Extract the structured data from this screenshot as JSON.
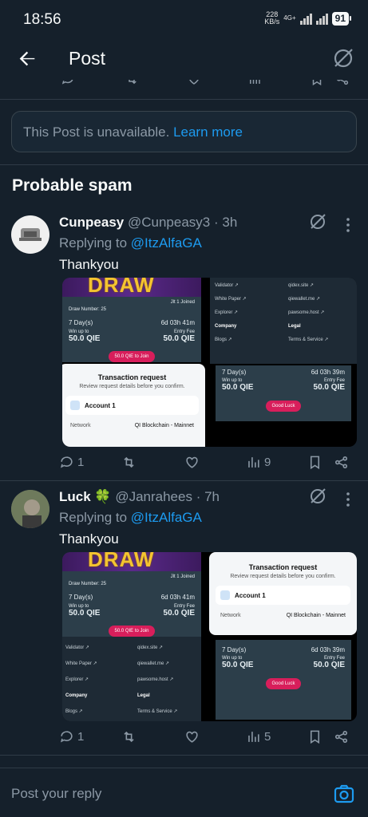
{
  "status": {
    "time": "18:56",
    "speed_value": "228",
    "speed_unit": "KB/s",
    "network": "4G+",
    "battery": "91"
  },
  "header": {
    "title": "Post",
    "back_icon": "arrow-left-icon",
    "grok_icon": "grok-icon"
  },
  "unavailable": {
    "text": "This Post is unavailable.",
    "link": "Learn more"
  },
  "section_title": "Probable spam",
  "replies": [
    {
      "name": "Cunpeasy",
      "handle": "@Cunpeasy3",
      "time": "· 3h",
      "replying_prefix": "Replying to",
      "replying_handle": "@ItzAlfaGA",
      "text": "Thankyou",
      "views": "9",
      "replies_count": "1",
      "retweets": "",
      "likes": ""
    },
    {
      "name": "Luck 🍀",
      "handle": "@Janrahees",
      "time": "· 7h",
      "replying_prefix": "Replying to",
      "replying_handle": "@ItzAlfaGA",
      "text": "Thankyou",
      "views": "5",
      "replies_count": "1",
      "retweets": "",
      "likes": ""
    }
  ],
  "media": {
    "banner": "DRAW",
    "draw_number": "Draw Number: 25",
    "joined": "Jlt 1 Joined",
    "days": "7 Day(s)",
    "time_left_a": "6d 03h 41m",
    "time_left_b": "6d 03h 39m",
    "win_label": "Win up to",
    "entry_label": "Entry Fee",
    "win_value": "50.0 QIE",
    "entry_value": "50.0 QIE",
    "join_button": "50.0 QIE to Join",
    "good_luck": "Good Luck",
    "tx_title": "Transaction request",
    "tx_sub": "Review request details before you confirm.",
    "account": "Account 1",
    "network_label": "Network",
    "network_value": "QI Blockchain - Mainnet",
    "links": {
      "validator": "Validator ↗",
      "whitepaper": "White Paper ↗",
      "explorer": "Explorer ↗",
      "company": "Company",
      "blogs": "Blogs ↗",
      "qidex": "qidex.site ↗",
      "qiewallet": "qiewallet.me ↗",
      "pawsome": "pawsome.host ↗",
      "legal": "Legal",
      "terms": "Terms & Service ↗"
    }
  },
  "composer": {
    "placeholder": "Post your reply",
    "camera_icon": "camera-icon"
  }
}
